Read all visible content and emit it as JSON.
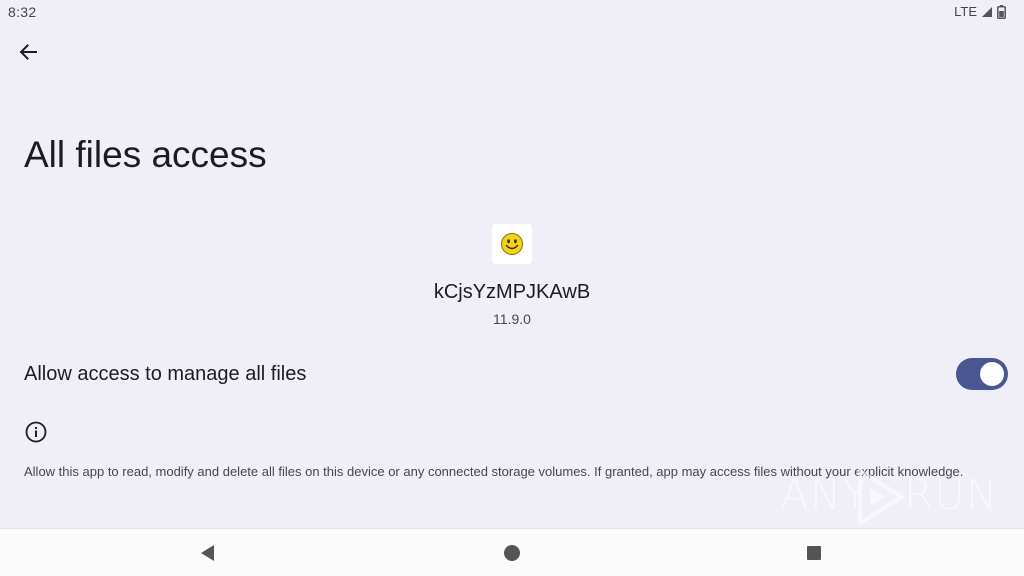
{
  "status_bar": {
    "time": "8:32",
    "network": "LTE"
  },
  "page": {
    "title": "All files access"
  },
  "app": {
    "name": "kCjsYzMPJKAwB",
    "version": "11.9.0",
    "icon": "smiley-icon"
  },
  "setting": {
    "label": "Allow access to manage all files",
    "enabled": true,
    "accent_color": "#4a5691"
  },
  "info": {
    "description": "Allow this app to read, modify and delete all files on this device or any connected storage volumes. If granted, app may access files without your explicit knowledge."
  },
  "watermark": {
    "left_text": "ANY",
    "right_text": "RUN"
  },
  "nav_bar": {
    "back": "back-triangle-icon",
    "home": "home-circle-icon",
    "recents": "recents-square-icon"
  }
}
